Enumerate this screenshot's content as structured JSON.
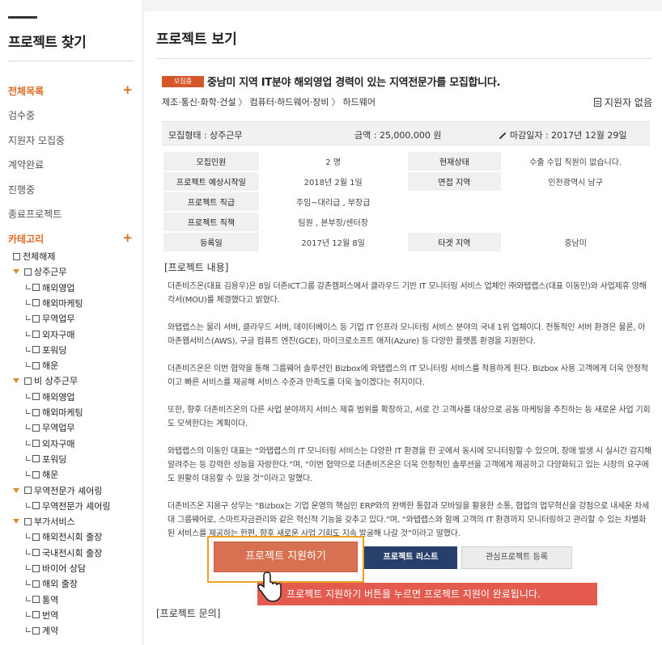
{
  "sidebar": {
    "title": "프로젝트 찾기",
    "sections": [
      {
        "label": "전체목록",
        "plus": "+"
      },
      {
        "label": "카테고리",
        "plus": "+"
      }
    ],
    "items": [
      "검수중",
      "지원자 모집중",
      "계약완료",
      "진행중",
      "종료프로젝트"
    ],
    "tree": [
      {
        "label": "전체해제",
        "level": 0
      },
      {
        "label": "상주근무",
        "level": 1
      },
      {
        "label": "해외영업",
        "level": 2
      },
      {
        "label": "해외마케팅",
        "level": 2
      },
      {
        "label": "무역업무",
        "level": 2
      },
      {
        "label": "외자구매",
        "level": 2
      },
      {
        "label": "포워딩",
        "level": 2
      },
      {
        "label": "해운",
        "level": 2
      },
      {
        "label": "비 상주근무",
        "level": 1
      },
      {
        "label": "해외영업",
        "level": 2
      },
      {
        "label": "해외마케팅",
        "level": 2
      },
      {
        "label": "무역업무",
        "level": 2
      },
      {
        "label": "외자구매",
        "level": 2
      },
      {
        "label": "포워딩",
        "level": 2
      },
      {
        "label": "해운",
        "level": 2
      },
      {
        "label": "무역전문가 셰어링",
        "level": 1
      },
      {
        "label": "무역전문가 셰어링",
        "level": 2
      },
      {
        "label": "부가서비스",
        "level": 1
      },
      {
        "label": "해외전시회 출장",
        "level": 2
      },
      {
        "label": "국내전시회 출장",
        "level": 2
      },
      {
        "label": "바이어 상담",
        "level": 2
      },
      {
        "label": "해외 출장",
        "level": 2
      },
      {
        "label": "통역",
        "level": 2
      },
      {
        "label": "번역",
        "level": 2
      },
      {
        "label": "계약",
        "level": 2
      }
    ]
  },
  "main": {
    "page_title": "프로젝트 보기",
    "badge": "모집중",
    "project_title": "중남미 지역 IT분야 해외영업 경력이 있는 지역전문가를 모집합니다.",
    "breadcrumb": [
      "제조·통신·화학·건설",
      "컴퓨터·하드웨어·장비",
      "하드웨어"
    ],
    "breadcrumb_sep": "〉",
    "applicants": "지원자 없음",
    "summary": {
      "type": "모집형태 : 상주근무",
      "amount": "금액 : 25,000,000 원",
      "deadline": "마감일자 : 2017년 12월 29일"
    },
    "info": [
      {
        "k1": "모집인원",
        "v1": "2 명",
        "k2": "현재상태",
        "v2": "수출 수입 직원이 없습니다."
      },
      {
        "k1": "프로젝트 예상시작일",
        "v1": "2018년 2월 1일",
        "k2": "면접 지역",
        "v2": "인천광역시 남구"
      },
      {
        "k1": "프로젝트 직급",
        "v1": "주임~대리급 , 부장급",
        "k2": "",
        "v2": ""
      },
      {
        "k1": "프로젝트 직책",
        "v1": "팀원 , 본부장/센터장",
        "k2": "",
        "v2": ""
      },
      {
        "k1": "등록일",
        "v1": "2017년 12월 8일",
        "k2": "타겟 지역",
        "v2": "중남미"
      }
    ],
    "content_label": "[프로젝트 내용]",
    "paragraphs": [
      "더존비즈온(대표 김용우)은 8일 더존ICT그룹 강촌캠퍼스에서 클라우드 기반 IT 모니터링 서비스 업체인 ㈜와탭랩스(대표 이동인)와 사업제휴 양해각서(MOU)를 체결했다고 밝혔다.",
      "와탭랩스는 물리 서버, 클라우드 서버, 데이터베이스 등 기업 IT 인프라 모니터링 서비스 분야의 국내 1위 업체이다. 전통적인 서버 환경은 물론, 아마존웹서비스(AWS), 구글 컴퓨트 엔진(GCE), 마이크로소프트 애저(Azure) 등 다양한 플랫폼 환경을 지원한다.",
      "더존비즈온은 이번 협약을 통해 그룹웨어 솔루션인 Bizbox에 와탭랩스의 IT 모니터링 서비스를 적용하게 된다. Bizbox 사용 고객에게 더욱 안정적이고 빠른 서비스를 제공해 서비스 수준과 만족도를 더욱 높이겠다는 취지이다.",
      "또한, 향후 더존비즈온의 다른 사업 분야까지 서비스 제휴 범위를 확장하고, 서로 간 고객사를 대상으로 공동 마케팅을 추진하는 등 새로운 사업 기회도 모색한다는 계획이다.",
      "와탭랩스의 이동인 대표는 “와탭랩스의 IT 모니터링 서비스는 다양한 IT 환경을 한 곳에서 동시에 모니터링할 수 있으며, 장애 발생 시 실시간 감지해 알려주는 등 강력한 성능을 자랑한다.”며, “이번 협약으로 더존비즈온은 더욱 안정적인 솔루션을 고객에게 제공하고 다양화되고 있는 시장의 요구에도 원활히 대응할 수 있을 것”이라고 말했다.",
      "더존비즈온 지용구 상무는 “Bizbox는 기업 운영의 핵심인 ERP와의 완벽한 통합과 모바일을 활용한 소통, 협업의 업무혁신을 강점으로 내세운 차세대 그룹웨어로, 스마트자금관리와 같은 혁신적 기능을 갖추고 있다.”며, “와탭랩스와 함께 고객의 IT 환경까지 모니터링하고 관리할 수 있는 차별화된 서비스를 제공하는 한편, 향후 새로운 사업 기회도 지속 발굴해 나갈 것”이라고 말했다."
    ],
    "buttons": {
      "apply": "프로젝트 지원하기",
      "list": "프로젝트 리스트",
      "favorite": "관심프로젝트 등록"
    },
    "tooltip": "프로젝트 지원하기 버튼을 누르면 프로젝트 지원이 완료됩니다.",
    "inquiry_label": "[프로젝트 문의]"
  },
  "colors": {
    "accent": "#e06a1f",
    "badge": "#d4572a",
    "apply_button": "#d77152",
    "list_button": "#273f6b",
    "highlight_frame": "#f0a020",
    "tooltip": "#e35a4f"
  }
}
